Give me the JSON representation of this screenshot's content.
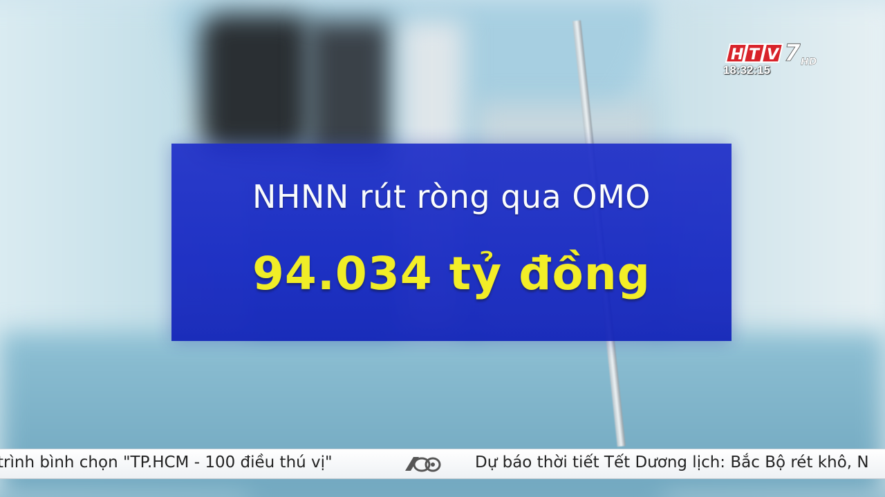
{
  "channel": {
    "logo_text": "HTV7",
    "logo_suffix": "HD",
    "clock": "18:32:15"
  },
  "info_panel": {
    "headline": "NHNN rút ròng qua OMO",
    "value": "94.034 tỷ đồng"
  },
  "ticker": {
    "left_text": "trình bình chọn \"TP.HCM - 100 điều thú vị\"",
    "right_text": "Dự báo thời tiết Tết Dương lịch: Bắc Bộ rét khô, N",
    "separator_icon": "channel-emblem-icon"
  },
  "colors": {
    "panel_blue": "#1426c2",
    "value_yellow": "#f7f01a",
    "logo_red": "#d8232a"
  }
}
